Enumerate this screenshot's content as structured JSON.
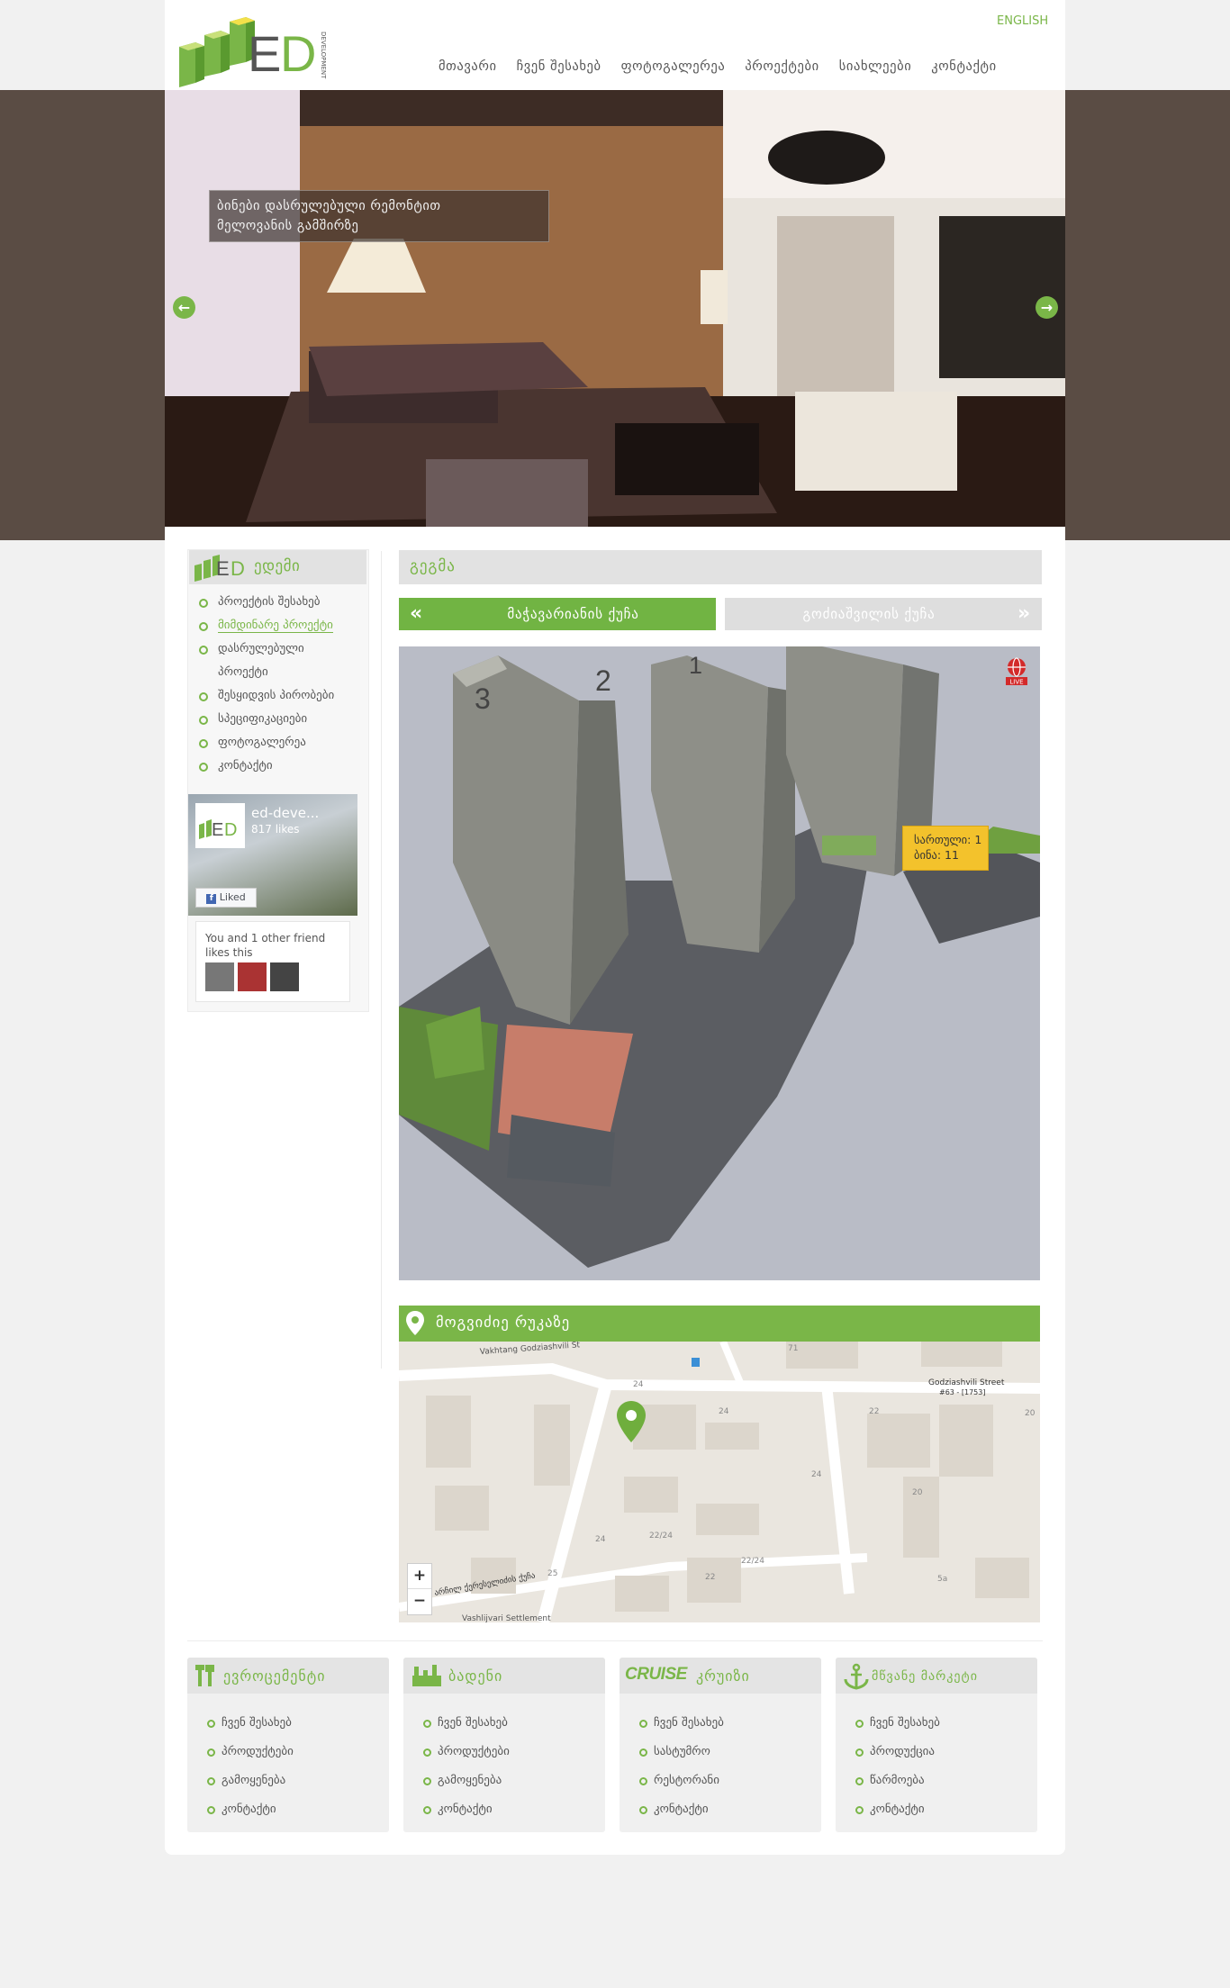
{
  "header": {
    "language": "ENGLISH",
    "nav": [
      "მთავარი",
      "ჩვენ შესახებ",
      "ფოტოგალერეა",
      "პროექტები",
      "სიახლეები",
      "კონტაქტი"
    ]
  },
  "hero": {
    "caption_line1": "ბინები დასრულებული რემონტით",
    "caption_line2": "მელოვანის გამშირზე"
  },
  "sidebar": {
    "title": "ედემი",
    "items": [
      "პროექტის შესახებ",
      "მიმდინარე პროექტი",
      "დასრულებული",
      "პროექტი",
      "შესყიდვის პირობები",
      "სპეციფიკაციები",
      "ფოტოგალერეა",
      "კონტაქტი"
    ],
    "active_index": 1
  },
  "facebook": {
    "page_name": "ed-deve...",
    "likes": "817 likes",
    "button": "Liked",
    "friends_text": "You and 1 other friend likes this"
  },
  "main": {
    "section_title": "გეგმა",
    "tab_active": "მაჭავარიანის ქუჩა",
    "tab_inactive": "გოძიაშვილის ქუჩა",
    "buildings": [
      "3",
      "2",
      "1"
    ],
    "live_label": "LIVE",
    "callout_floor": "სართული: 1",
    "callout_flat": "ბინა: 11",
    "map_title": "მოგვიძიე რუკაზე"
  },
  "map": {
    "street_top": "Vakhtang Godziashvili St",
    "label_right": "Godziashvili Street",
    "label_right2": "#63 - [1753]",
    "street_left": "არჩილ ქერესელიძის ქუჩა",
    "street_bottom": "Vashlijvari Settlement",
    "house_numbers": [
      "24",
      "24",
      "22",
      "24",
      "22/24",
      "22/24",
      "22",
      "20",
      "71",
      "20",
      "24",
      "25",
      "5a"
    ],
    "zoom_in": "+",
    "zoom_out": "−"
  },
  "footer": {
    "columns": [
      {
        "title": "ევროცემენტი",
        "items": [
          "ჩვენ შესახებ",
          "პროდუქტები",
          "გამოყენება",
          "კონტაქტი"
        ]
      },
      {
        "title": "ბადენი",
        "items": [
          "ჩვენ შესახებ",
          "პროდუქტები",
          "გამოყენება",
          "კონტაქტი"
        ]
      },
      {
        "title": "კრუიზი",
        "brand": "CRUISE",
        "items": [
          "ჩვენ შესახებ",
          "სასტუმრო",
          "რესტორანი",
          "კონტაქტი"
        ]
      },
      {
        "title": "მწვანე მარკეტი",
        "items": [
          "ჩვენ შესახებ",
          "პროდუქცია",
          "წარმოება",
          "კონტაქტი"
        ]
      }
    ]
  },
  "colors": {
    "accent": "#7ab648",
    "tab_active": "#71b443",
    "callout": "#f3c22c",
    "band": "#5a4c44"
  }
}
